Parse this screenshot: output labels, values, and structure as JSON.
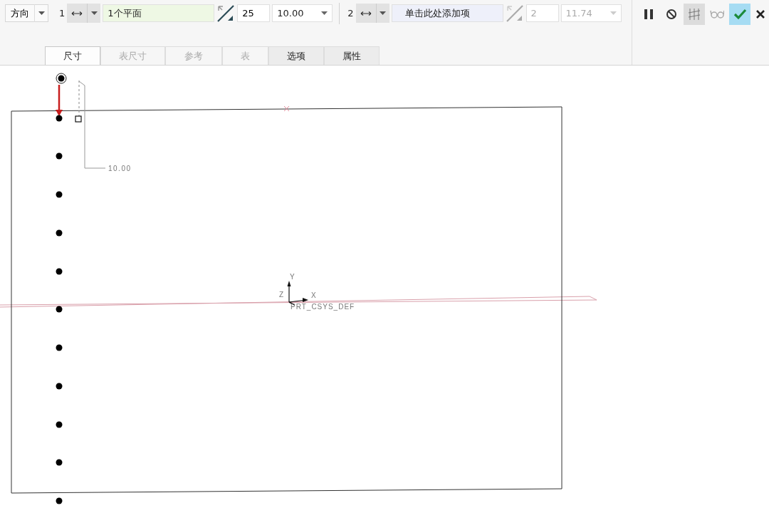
{
  "toolbar": {
    "direction_button": "方向",
    "sets": [
      {
        "index": "1",
        "reference": "1个平面",
        "count": "25",
        "spacing": "10.00",
        "disabled": false
      },
      {
        "index": "2",
        "placeholder": "单击此处添加项",
        "count": "2",
        "spacing": "11.74",
        "disabled": true
      }
    ]
  },
  "tabs": [
    {
      "label": "尺寸",
      "selected": true,
      "disabled": false
    },
    {
      "label": "表尺寸",
      "selected": false,
      "disabled": true
    },
    {
      "label": "参考",
      "selected": false,
      "disabled": true
    },
    {
      "label": "表",
      "selected": false,
      "disabled": true
    },
    {
      "label": "选项",
      "selected": false,
      "disabled": false
    },
    {
      "label": "属性",
      "selected": false,
      "disabled": false
    }
  ],
  "actions": [
    {
      "kind": "pause",
      "pressed": false
    },
    {
      "kind": "stop",
      "pressed": false
    },
    {
      "kind": "preview",
      "pressed": true
    },
    {
      "kind": "glasses",
      "pressed": false
    },
    {
      "kind": "accept",
      "pressed": false
    },
    {
      "kind": "cancel",
      "pressed": false
    }
  ],
  "canvas": {
    "dimension": "10.00",
    "csys": {
      "name": "PRT_CSYS_DEF",
      "axes": [
        "Y",
        "Z",
        "X"
      ]
    }
  }
}
